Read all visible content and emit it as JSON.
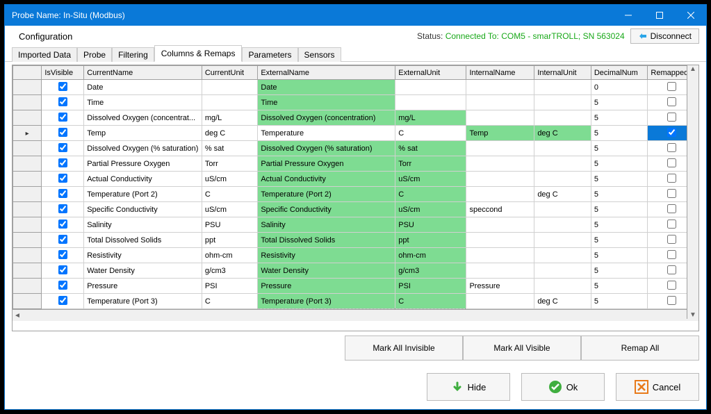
{
  "window": {
    "title": "Probe Name: In-Situ (Modbus)"
  },
  "topbar": {
    "config_label": "Configuration",
    "status_label": "Status:",
    "status_value": "Connected To: COM5 - smarTROLL; SN 563024",
    "disconnect_label": "Disconnect"
  },
  "tabs": [
    "Imported Data",
    "Probe",
    "Filtering",
    "Columns & Remaps",
    "Parameters",
    "Sensors"
  ],
  "active_tab_index": 3,
  "columns": [
    "IsVisible",
    "CurrentName",
    "CurrentUnit",
    "ExternalName",
    "ExternalUnit",
    "InternalName",
    "InternalUnit",
    "DecimalNum",
    "Remapped"
  ],
  "rows": [
    {
      "vis": true,
      "cname": "Date",
      "cunit": "",
      "ename": "Date",
      "eunit": "",
      "iname": "",
      "iunit": "",
      "dec": "0",
      "remap": false,
      "eg": true,
      "eug": false
    },
    {
      "vis": true,
      "cname": "Time",
      "cunit": "",
      "ename": "Time",
      "eunit": "",
      "iname": "",
      "iunit": "",
      "dec": "5",
      "remap": false,
      "eg": true,
      "eug": false
    },
    {
      "vis": true,
      "cname": "Dissolved Oxygen (concentrat...",
      "cunit": "mg/L",
      "ename": "Dissolved Oxygen (concentration)",
      "eunit": "mg/L",
      "iname": "",
      "iunit": "",
      "dec": "5",
      "remap": false,
      "eg": true,
      "eug": true
    },
    {
      "vis": true,
      "cname": "Temp",
      "cunit": "deg C",
      "ename": "Temperature",
      "eunit": "C",
      "iname": "Temp",
      "iunit": "deg C",
      "dec": "5",
      "remap": true,
      "eg": false,
      "eug": false,
      "cur": true,
      "ig": true
    },
    {
      "vis": true,
      "cname": "Dissolved Oxygen (% saturation)",
      "cunit": "% sat",
      "ename": "Dissolved Oxygen (% saturation)",
      "eunit": "% sat",
      "iname": "",
      "iunit": "",
      "dec": "5",
      "remap": false,
      "eg": true,
      "eug": true
    },
    {
      "vis": true,
      "cname": "Partial Pressure Oxygen",
      "cunit": "Torr",
      "ename": "Partial Pressure Oxygen",
      "eunit": "Torr",
      "iname": "",
      "iunit": "",
      "dec": "5",
      "remap": false,
      "eg": true,
      "eug": true
    },
    {
      "vis": true,
      "cname": "Actual Conductivity",
      "cunit": "uS/cm",
      "ename": "Actual Conductivity",
      "eunit": "uS/cm",
      "iname": "",
      "iunit": "",
      "dec": "5",
      "remap": false,
      "eg": true,
      "eug": true
    },
    {
      "vis": true,
      "cname": "Temperature (Port 2)",
      "cunit": "C",
      "ename": "Temperature (Port 2)",
      "eunit": "C",
      "iname": "",
      "iunit": "deg C",
      "dec": "5",
      "remap": false,
      "eg": true,
      "eug": true
    },
    {
      "vis": true,
      "cname": "Specific Conductivity",
      "cunit": "uS/cm",
      "ename": "Specific Conductivity",
      "eunit": "uS/cm",
      "iname": "speccond",
      "iunit": "",
      "dec": "5",
      "remap": false,
      "eg": true,
      "eug": true
    },
    {
      "vis": true,
      "cname": "Salinity",
      "cunit": "PSU",
      "ename": "Salinity",
      "eunit": "PSU",
      "iname": "",
      "iunit": "",
      "dec": "5",
      "remap": false,
      "eg": true,
      "eug": true
    },
    {
      "vis": true,
      "cname": "Total Dissolved Solids",
      "cunit": "ppt",
      "ename": "Total Dissolved Solids",
      "eunit": "ppt",
      "iname": "",
      "iunit": "",
      "dec": "5",
      "remap": false,
      "eg": true,
      "eug": true
    },
    {
      "vis": true,
      "cname": "Resistivity",
      "cunit": "ohm-cm",
      "ename": "Resistivity",
      "eunit": "ohm-cm",
      "iname": "",
      "iunit": "",
      "dec": "5",
      "remap": false,
      "eg": true,
      "eug": true
    },
    {
      "vis": true,
      "cname": "Water Density",
      "cunit": "g/cm3",
      "ename": "Water Density",
      "eunit": "g/cm3",
      "iname": "",
      "iunit": "",
      "dec": "5",
      "remap": false,
      "eg": true,
      "eug": true
    },
    {
      "vis": true,
      "cname": "Pressure",
      "cunit": "PSI",
      "ename": "Pressure",
      "eunit": "PSI",
      "iname": "Pressure",
      "iunit": "",
      "dec": "5",
      "remap": false,
      "eg": true,
      "eug": true
    },
    {
      "vis": true,
      "cname": "Temperature (Port 3)",
      "cunit": "C",
      "ename": "Temperature (Port 3)",
      "eunit": "C",
      "iname": "",
      "iunit": "deg C",
      "dec": "5",
      "remap": false,
      "eg": true,
      "eug": true
    }
  ],
  "buttons": {
    "mark_invisible": "Mark All Invisible",
    "mark_visible": "Mark All Visible",
    "remap_all": "Remap All",
    "hide": "Hide",
    "ok": "Ok",
    "cancel": "Cancel"
  }
}
